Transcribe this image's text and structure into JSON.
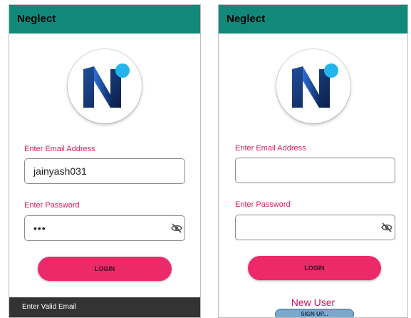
{
  "screens": [
    {
      "app_title": "Neglect",
      "email_label": "Enter Email Address",
      "email_value": "jainyash031",
      "password_label": "Enter Password",
      "password_value": "•••",
      "login_label": "LOGIN",
      "snackbar_text": "Enter Valid Email"
    },
    {
      "app_title": "Neglect",
      "email_label": "Enter Email Address",
      "email_value": "",
      "password_label": "Enter Password",
      "password_value": "",
      "login_label": "LOGIN",
      "new_user_text": "New User",
      "signup_label": "SIGN UP..."
    }
  ],
  "colors": {
    "appbar": "#11897a",
    "accent_label": "#d81b60",
    "login_button": "#ec2a69",
    "signup_button": "#79a9cf",
    "snackbar": "#333333"
  },
  "icons": {
    "logo": "n-logo-icon",
    "password_toggle": "eye-off-icon"
  }
}
